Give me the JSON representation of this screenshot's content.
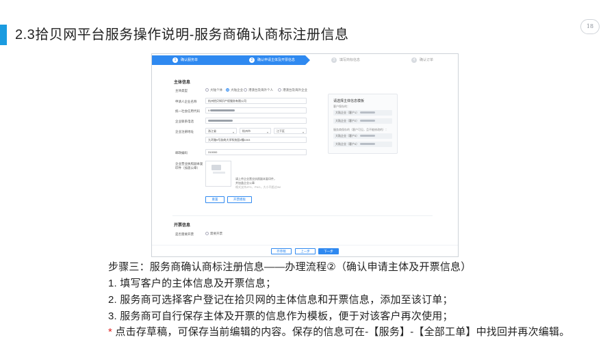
{
  "slide": {
    "title": "2.3拾贝网平台服务操作说明-服务商确认商标注册信息",
    "page_number": "18"
  },
  "stepper": {
    "steps": [
      {
        "num": "1",
        "label": "确认服务单"
      },
      {
        "num": "2",
        "label": "确认申请主体及开票信息"
      },
      {
        "num": "3",
        "label": "填写商标信息"
      },
      {
        "num": "4",
        "label": "确认订单"
      }
    ],
    "active_index": 1
  },
  "form": {
    "subject_section": "主体信息",
    "subject_type_label": "主体类型",
    "subject_type_options": [
      "大陆个体",
      "大陆企业",
      "港澳台及海外个人",
      "港澳台及海外企业"
    ],
    "subject_type_selected": "大陆企业",
    "applicant_name_label": "申请人企业名称",
    "applicant_name_value": "杭州拾贝知识产权服务有限公司",
    "credit_code_label": "统一社会信用代码",
    "credit_code_value": "9",
    "phone_label": "企业联系电话",
    "address_label": "企业注册地址",
    "province": "浙江省",
    "city": "杭州市",
    "district": "江干区",
    "address_detail": "九环路9号浙商大学科技园1幢1003",
    "postcode_label": "邮政编码",
    "postcode_value": "310000",
    "license_label": "企业营业执照副本复印件（加盖公章）",
    "upload_tip": "请上传企业营业执照副本复印件，并加盖企业公章",
    "upload_format": "格式支持JPG、PNG，大小不超过5M",
    "reupload_button": "重置",
    "upload_button": "开票模板",
    "invoice_section": "开票信息",
    "invoice_need_label": "是否需要开票",
    "invoice_option": "需要开票"
  },
  "template_panel": {
    "title": "请选择主体信息模板",
    "customer_saved_label": "客户保存的：",
    "customer_items": [
      "大陆企业（客户1）",
      "大陆企业（客户2）"
    ],
    "provider_saved_label": "服务商保存的（客户可见，且不能修改的）：",
    "provider_items": [
      "大陆企业（客户3）",
      "大陆企业（客户4）"
    ]
  },
  "footer": {
    "draft_button": "存草稿",
    "prev_button": "上一步",
    "next_button": "下一步"
  },
  "description": {
    "step_title": "步骤三：服务商确认商标注册信息——办理流程②（确认申请主体及开票信息）",
    "item1": "1.   填写客户的主体信息及开票信息；",
    "item2": "2.   服务商可选择客户登记在拾贝网的主体信息和开票信息，添加至该订单；",
    "item3": "3.   服务商可自行保存主体及开票的信息作为模板，便于对该客户再次使用；",
    "note_mark": "*",
    "note": " 点击存草稿，可保存当前编辑的内容。保存的信息可在-【服务】-【全部工单】中找回并再次编辑。"
  },
  "colors": {
    "accent": "#1a9be0",
    "primary_button": "#2f89f0",
    "note_star": "#e02020"
  }
}
